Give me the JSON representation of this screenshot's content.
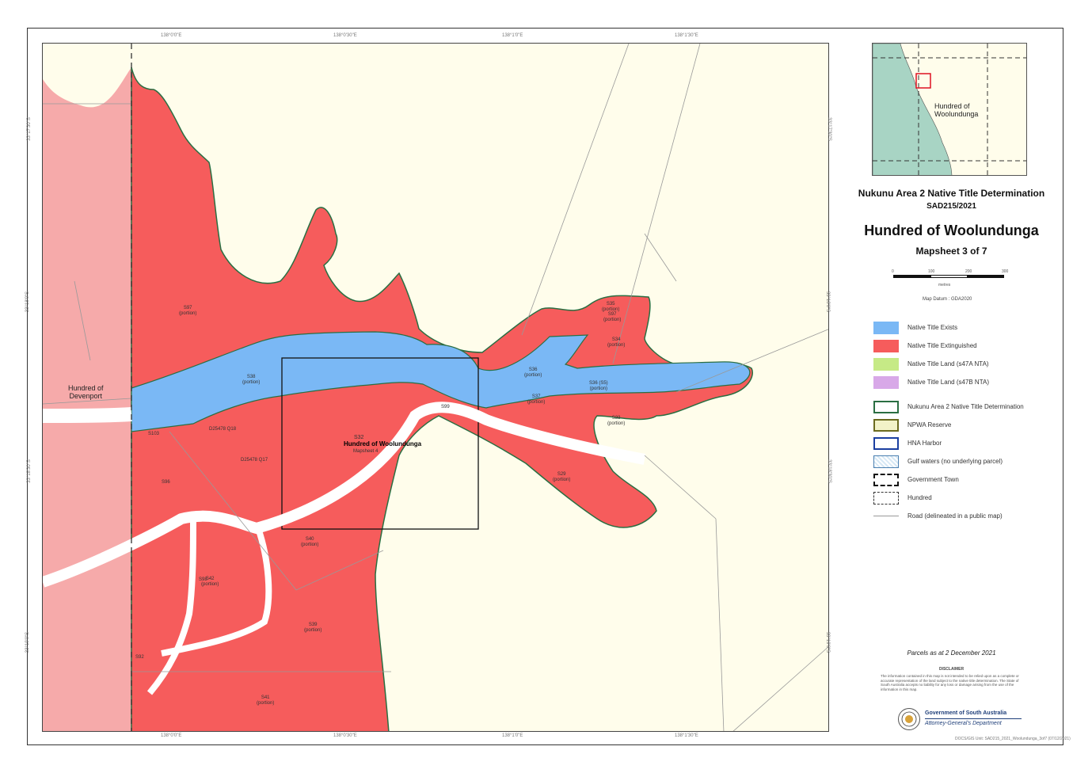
{
  "colors": {
    "ntExists": "#7ab8f5",
    "ntExtinguished": "#f65c5c",
    "ntLand47A": "#c6ea86",
    "ntLand47B": "#d8a8e8",
    "neighbourHundred": "#f6aaaa",
    "background": "#fffdeb",
    "sea": "#a8d4c4",
    "determinationBoundary": "#2a6e42",
    "harbour": "#1b3fa0"
  },
  "grid_labels": {
    "top": [
      "138°0'0\"E",
      "138°0'30\"E",
      "138°1'0\"E",
      "138°1'30\"E"
    ],
    "bottom": [
      "138°0'0\"E",
      "138°0'30\"E",
      "138°1'0\"E",
      "138°1'30\"E"
    ],
    "left": [
      "33°17'30\"S",
      "33°18'0\"S",
      "33°18'30\"S",
      "33°19'0\"S"
    ],
    "right": [
      "33°17'30\"S",
      "33°18'0\"S",
      "33°18'30\"S",
      "33°19'0\"S"
    ]
  },
  "map_labels": {
    "hundred_devenport": "Hundred of\nDevenport",
    "focus_title": "Hundred of Woolundunga",
    "focus_sub": "Mapsheet 4",
    "focus_top": "S32",
    "parcels": [
      {
        "id": "s97",
        "text": "S97\n(portion)"
      },
      {
        "id": "s96",
        "text": "S96"
      },
      {
        "id": "s98",
        "text": "S98"
      },
      {
        "id": "s92",
        "text": "S92"
      },
      {
        "id": "q",
        "text": "S97\n(portion)"
      },
      {
        "id": "s99",
        "text": "S99"
      },
      {
        "id": "s103",
        "text": "S103"
      },
      {
        "id": "dp",
        "text": "D25478 Q17"
      },
      {
        "id": "dp2",
        "text": "D25478 Q18"
      },
      {
        "id": "sec1",
        "text": "S38\n(portion)"
      },
      {
        "id": "sec2",
        "text": "S36\n(portion)"
      },
      {
        "id": "sec3",
        "text": "S37\n(portion)"
      },
      {
        "id": "sec4",
        "text": "S36 (S5)\n(portion)"
      },
      {
        "id": "sec5",
        "text": "S34\n(portion)"
      },
      {
        "id": "sec6",
        "text": "S35\n(portion)"
      },
      {
        "id": "sec7",
        "text": "S33\n(portion)"
      },
      {
        "id": "sec8",
        "text": "S29\n(portion)"
      },
      {
        "id": "sec9",
        "text": "S40\n(portion)"
      },
      {
        "id": "sec10",
        "text": "S39\n(portion)"
      },
      {
        "id": "sec11",
        "text": "S41\n(portion)"
      },
      {
        "id": "sec12",
        "text": "S42\n(portion)"
      }
    ]
  },
  "inset": {
    "label": "Hundred of\nWoolundunga"
  },
  "titles": {
    "determination": "Nukunu Area 2 Native Title Determination",
    "file_no": "SAD215/2021",
    "hundred": "Hundred of Woolundunga",
    "mapsheet": "Mapsheet 3 of 7"
  },
  "scale": {
    "ticks": [
      "0",
      "100",
      "200",
      "300"
    ],
    "unit": "metres",
    "datum": "Map Datum : GDA2020"
  },
  "legend": [
    {
      "key": "nt_exists",
      "label": "Native Title Exists"
    },
    {
      "key": "nt_extinguished",
      "label": "Native Title Extinguished"
    },
    {
      "key": "nt_land_47a",
      "label": "Native Title Land (s47A NTA)"
    },
    {
      "key": "nt_land_47b",
      "label": "Native Title Land (s47B NTA)"
    },
    {
      "key": "determination",
      "label": "Nukunu Area 2 Native Title Determination"
    },
    {
      "key": "npwa",
      "label": "NPWA Reserve"
    },
    {
      "key": "harbor",
      "label": "HNA Harbor"
    },
    {
      "key": "gulf",
      "label": "Gulf waters (no underlying parcel)"
    },
    {
      "key": "govt_town",
      "label": "Government Town"
    },
    {
      "key": "hundred",
      "label": "Hundred"
    },
    {
      "key": "road",
      "label": "Road (delineated in a public map)"
    }
  ],
  "parcels_note": "Parcels as at 2 December 2021",
  "disclaimer": {
    "heading": "DISCLAIMER",
    "body": "The information contained in this map is not intended to be relied upon as a complete or accurate representation of the land subject to the native title determination. The State of South Australia accepts no liability for any loss or damage arising from the use of the information in this map."
  },
  "agency": {
    "line1": "Government of South Australia",
    "line2": "Attorney-General's Department"
  },
  "footer_code": "DOCS/GIS Unit: SAD215_2021_Woolundunga_3of7 (07/12/2021)"
}
